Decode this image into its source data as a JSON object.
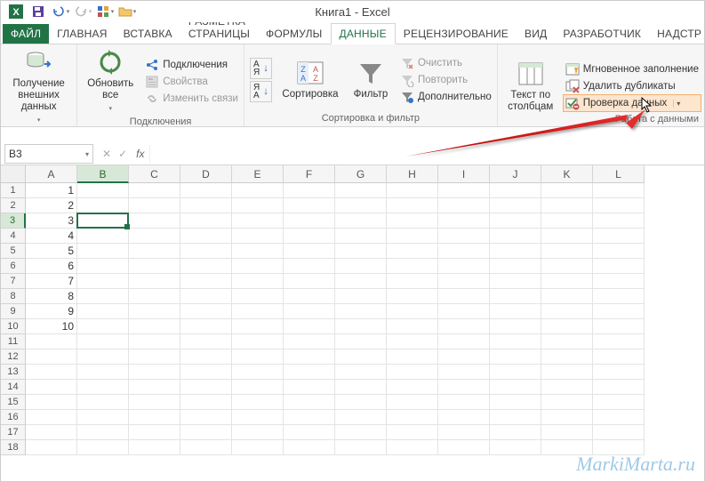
{
  "title": {
    "book": "Книга1",
    "app": "Excel"
  },
  "qat": {
    "icons": [
      "excel-icon",
      "save-icon",
      "undo-icon",
      "redo-icon",
      "touch-icon",
      "folder-icon"
    ]
  },
  "tabs": {
    "file": "ФАЙЛ",
    "items": [
      "ГЛАВНАЯ",
      "ВСТАВКА",
      "РАЗМЕТКА СТРАНИЦЫ",
      "ФОРМУЛЫ",
      "ДАННЫЕ",
      "РЕЦЕНЗИРОВАНИЕ",
      "ВИД",
      "РАЗРАБОТЧИК",
      "НАДСТР"
    ],
    "active_index": 4
  },
  "ribbon": {
    "groups": {
      "get_data": {
        "big": "Получение\nвнешних данных"
      },
      "connections": {
        "big": "Обновить\nвсе",
        "items": [
          "Подключения",
          "Свойства",
          "Изменить связи"
        ],
        "label": "Подключения"
      },
      "sort_filter": {
        "sort_az": "А↓Я",
        "sort_za": "Я↓А",
        "sort_big": "Сортировка",
        "filter_big": "Фильтр",
        "items": [
          "Очистить",
          "Повторить",
          "Дополнительно"
        ],
        "label": "Сортировка и фильтр"
      },
      "data_tools": {
        "text_to_columns": "Текст по\nстолбцам",
        "items": [
          "Мгновенное заполнение",
          "Удалить дубликаты",
          "Проверка данных"
        ],
        "label": "Работа с данными"
      }
    }
  },
  "formula_bar": {
    "namebox": "B3",
    "fx": "fx",
    "value": ""
  },
  "grid": {
    "columns": [
      "A",
      "B",
      "C",
      "D",
      "E",
      "F",
      "G",
      "H",
      "I",
      "J",
      "K",
      "L"
    ],
    "active_col": "B",
    "active_row": 3,
    "row_count": 18,
    "data": {
      "A": [
        "1",
        "2",
        "3",
        "4",
        "5",
        "6",
        "7",
        "8",
        "9",
        "10"
      ]
    }
  },
  "watermark": "MarkiMarta.ru"
}
